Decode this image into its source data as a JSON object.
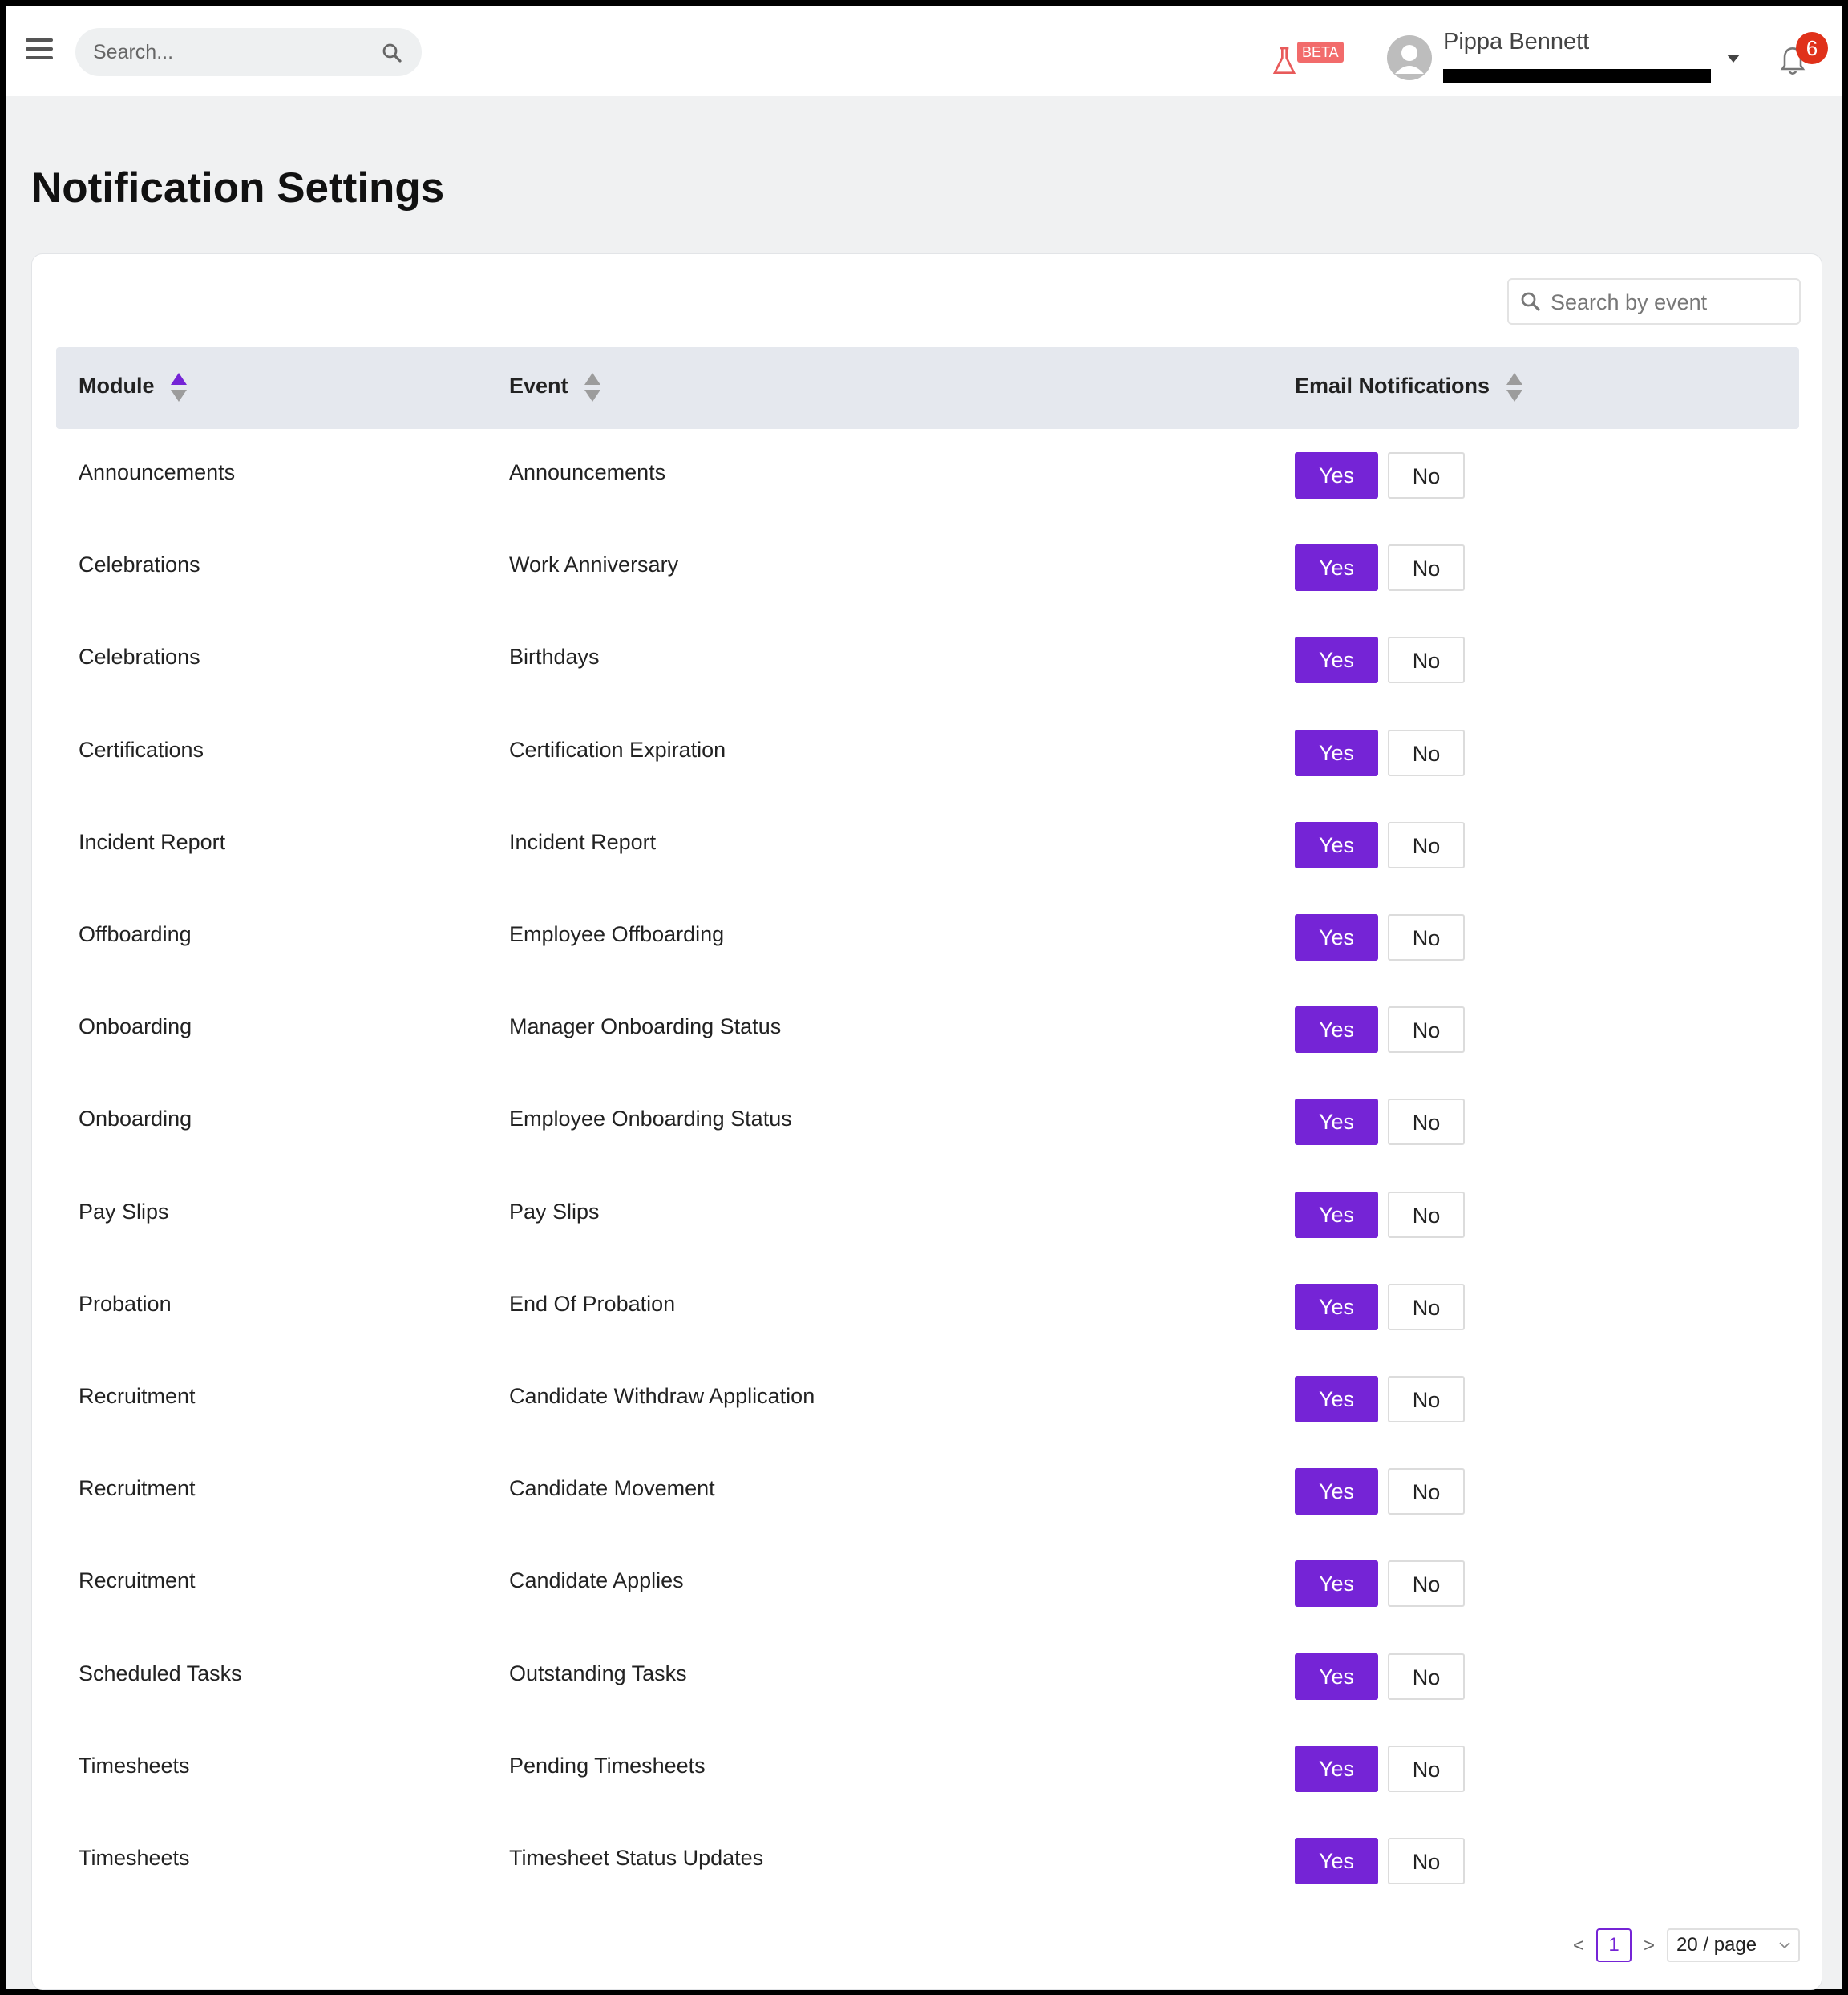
{
  "header": {
    "search_placeholder": "Search...",
    "beta_label": "BETA",
    "user_name": "Pippa Bennett",
    "notification_count": "6"
  },
  "page": {
    "title": "Notification Settings",
    "event_search_placeholder": "Search by event"
  },
  "table": {
    "columns": [
      "Module",
      "Event",
      "Email Notifications"
    ],
    "rows": [
      {
        "module": "Announcements",
        "event": "Announcements",
        "yes": "Yes",
        "no": "No"
      },
      {
        "module": "Celebrations",
        "event": "Work Anniversary",
        "yes": "Yes",
        "no": "No"
      },
      {
        "module": "Celebrations",
        "event": "Birthdays",
        "yes": "Yes",
        "no": "No"
      },
      {
        "module": "Certifications",
        "event": "Certification Expiration",
        "yes": "Yes",
        "no": "No"
      },
      {
        "module": "Incident Report",
        "event": "Incident Report",
        "yes": "Yes",
        "no": "No"
      },
      {
        "module": "Offboarding",
        "event": "Employee Offboarding",
        "yes": "Yes",
        "no": "No"
      },
      {
        "module": "Onboarding",
        "event": "Manager Onboarding Status",
        "yes": "Yes",
        "no": "No"
      },
      {
        "module": "Onboarding",
        "event": "Employee Onboarding Status",
        "yes": "Yes",
        "no": "No"
      },
      {
        "module": "Pay Slips",
        "event": "Pay Slips",
        "yes": "Yes",
        "no": "No"
      },
      {
        "module": "Probation",
        "event": "End Of Probation",
        "yes": "Yes",
        "no": "No"
      },
      {
        "module": "Recruitment",
        "event": "Candidate Withdraw Application",
        "yes": "Yes",
        "no": "No"
      },
      {
        "module": "Recruitment",
        "event": "Candidate Movement",
        "yes": "Yes",
        "no": "No"
      },
      {
        "module": "Recruitment",
        "event": "Candidate Applies",
        "yes": "Yes",
        "no": "No"
      },
      {
        "module": "Scheduled Tasks",
        "event": "Outstanding Tasks",
        "yes": "Yes",
        "no": "No"
      },
      {
        "module": "Timesheets",
        "event": "Pending Timesheets",
        "yes": "Yes",
        "no": "No"
      },
      {
        "module": "Timesheets",
        "event": "Timesheet Status Updates",
        "yes": "Yes",
        "no": "No"
      }
    ]
  },
  "pagination": {
    "prev": "<",
    "current_page": "1",
    "next": ">",
    "page_size": "20 / page"
  },
  "colors": {
    "accent": "#7524d6",
    "badge": "#e0311a",
    "beta": "#f26b6b"
  }
}
